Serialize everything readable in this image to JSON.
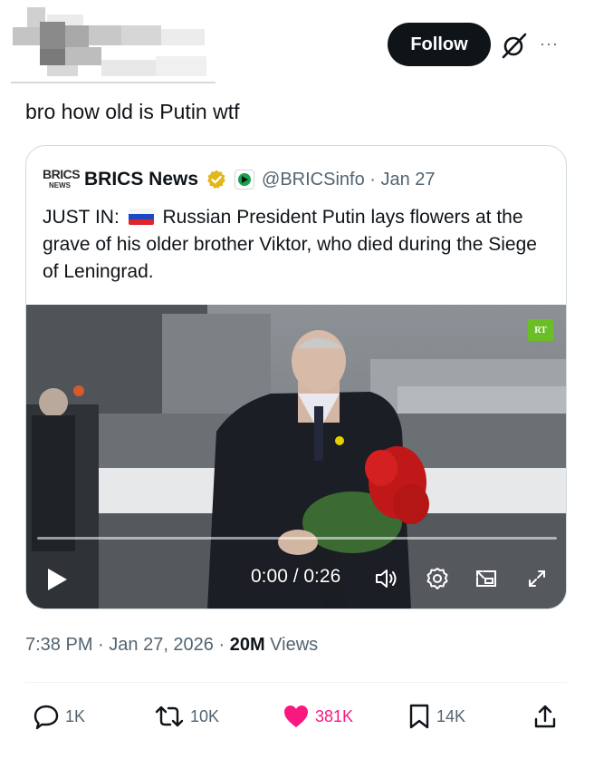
{
  "header": {
    "follow_label": "Follow",
    "more_label": "···"
  },
  "post": {
    "text": "bro how old is Putin wtf"
  },
  "quote": {
    "logo_line1": "BRICS",
    "logo_line2": "NEWS",
    "name": "BRICS News",
    "handle_date": "@BRICSinfo · Jan 27",
    "text_prefix": "JUST IN:",
    "text_body": "Russian President Putin lays flowers at the grave of his older brother Viktor, who died during the Siege of Leningrad.",
    "video": {
      "watermark": "RT",
      "time": "0:00 / 0:26",
      "progress": 0
    }
  },
  "meta": {
    "time": "7:38 PM",
    "date": "Jan 27, 2026",
    "views_count": "20M",
    "views_label": "Views"
  },
  "actions": {
    "replies": "1K",
    "reposts": "10K",
    "likes": "381K",
    "bookmarks": "14K"
  },
  "colors": {
    "text_primary": "#0f1419",
    "text_secondary": "#536471",
    "like_pink": "#f91880",
    "verified_gold": "#e2b719",
    "border": "#cfd9de"
  },
  "icons": [
    "grok-icon",
    "more-icon",
    "verified-icon",
    "brics-badge-icon",
    "russia-flag-icon",
    "play-icon",
    "volume-icon",
    "settings-icon",
    "pip-icon",
    "fullscreen-icon",
    "reply-icon",
    "repost-icon",
    "like-icon",
    "bookmark-icon",
    "share-icon"
  ]
}
